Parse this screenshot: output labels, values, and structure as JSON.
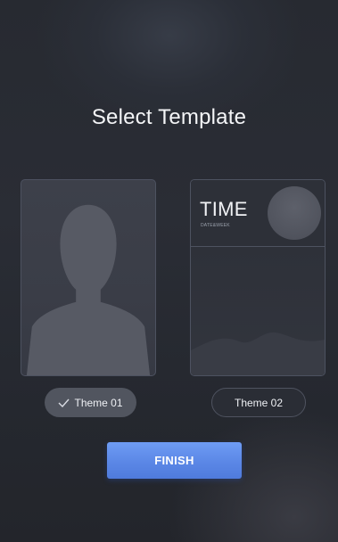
{
  "title": "Select Template",
  "templates": [
    {
      "label": "Theme 01",
      "selected": true
    },
    {
      "label": "Theme 02",
      "selected": false,
      "preview_time": "TIME",
      "preview_date": "DATE&WEEK"
    }
  ],
  "finish_label": "FINISH",
  "colors": {
    "background": "#272a31",
    "accent": "#5b87e6",
    "selected_pill": "#51555f",
    "card_border": "#4d5260"
  },
  "icons": {
    "check": "check-icon",
    "person_silhouette": "person-silhouette-icon"
  }
}
